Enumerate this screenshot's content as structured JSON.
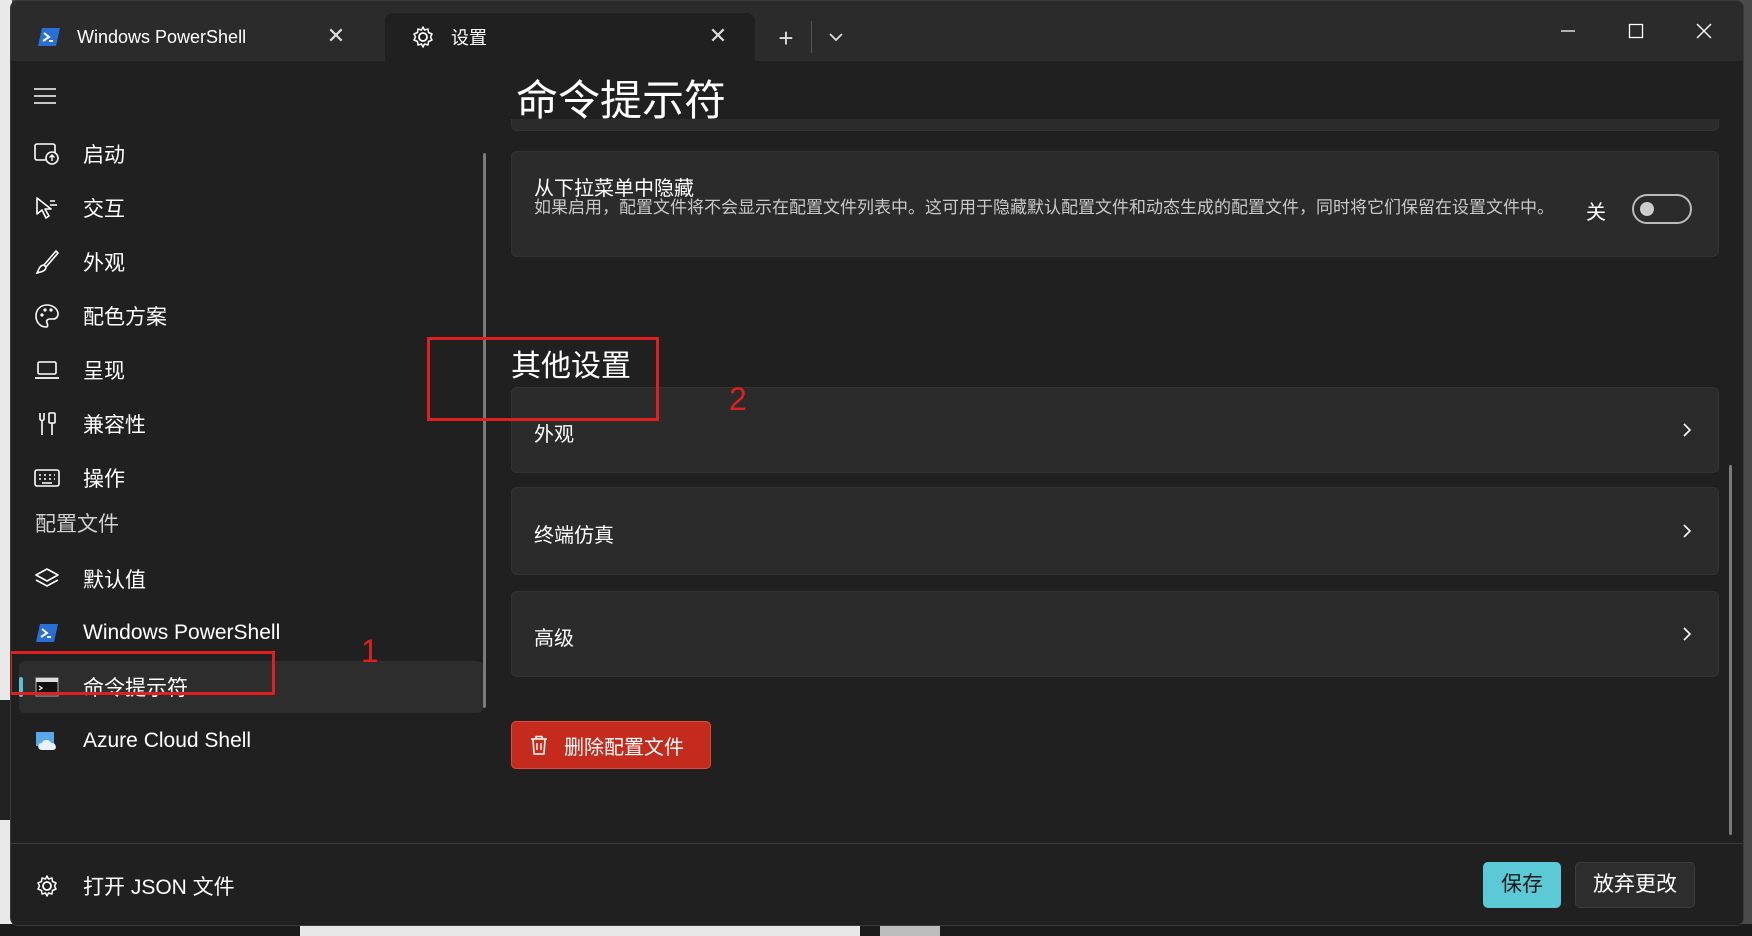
{
  "titlebar": {
    "tabs": [
      {
        "label": "Windows PowerShell",
        "icon": "powershell-icon"
      },
      {
        "label": "设置",
        "icon": "gear-icon"
      }
    ],
    "new_tab_glyph": "+",
    "window_controls": [
      "minimize",
      "maximize",
      "close"
    ]
  },
  "sidebar": {
    "items": [
      {
        "label": "启动",
        "icon": "startup-icon"
      },
      {
        "label": "交互",
        "icon": "interaction-icon"
      },
      {
        "label": "外观",
        "icon": "brush-icon"
      },
      {
        "label": "配色方案",
        "icon": "palette-icon"
      },
      {
        "label": "呈现",
        "icon": "laptop-icon"
      },
      {
        "label": "兼容性",
        "icon": "tools-icon"
      },
      {
        "label": "操作",
        "icon": "keyboard-icon"
      }
    ],
    "profiles_header": "配置文件",
    "profiles": [
      {
        "label": "默认值",
        "icon": "layers-icon"
      },
      {
        "label": "Windows PowerShell",
        "icon": "powershell-icon"
      },
      {
        "label": "命令提示符",
        "icon": "cmd-icon",
        "active": true
      },
      {
        "label": "Azure Cloud Shell",
        "icon": "azure-cloud-icon"
      }
    ],
    "footer": {
      "label": "打开 JSON 文件",
      "icon": "gear-icon"
    }
  },
  "main": {
    "title": "命令提示符",
    "hide_setting": {
      "title": "从下拉菜单中隐藏",
      "description": "如果启用，配置文件将不会显示在配置文件列表中。这可用于隐藏默认配置文件和动态生成的配置文件，同时将它们保留在设置文件中。",
      "state_label": "关",
      "value": false
    },
    "other_settings_header": "其他设置",
    "nav_cards": [
      "外观",
      "终端仿真",
      "高级"
    ],
    "delete_button": "删除配置文件"
  },
  "footer": {
    "save": "保存",
    "discard": "放弃更改"
  },
  "annotations": {
    "marker_1": "1",
    "marker_2": "2",
    "color": "#e02020"
  },
  "colors": {
    "accent": "#5ccad6",
    "danger": "#c42b1c",
    "background": "#202020",
    "card": "#2b2b2b"
  }
}
